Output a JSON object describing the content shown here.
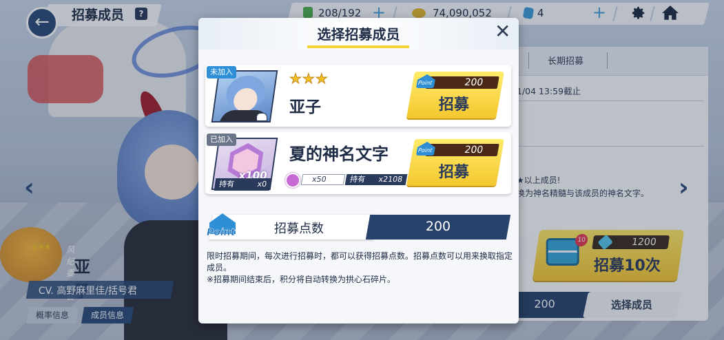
{
  "header": {
    "title": "招募成员",
    "help": "?",
    "resources": {
      "ap": "208/192",
      "credits": "74,090,052",
      "gems": "4"
    }
  },
  "background": {
    "right_panel": {
      "tab_long": "长期招募",
      "deadline": "1/04 13:59截止",
      "desc_line1": "★以上成员!",
      "desc_line2": "换为神名精髓与该成员的神名文字。"
    },
    "recruit10": {
      "badge": "10",
      "cost": "1200",
      "label": "招募10次"
    },
    "points_value": "200",
    "select_member": "选择成员",
    "character": {
      "stars": "★★★",
      "club": "风纪委员会",
      "name": "亚子",
      "cv": "CV. 高野麻里佳/括号君",
      "tab_prob": "概率信息",
      "tab_member": "成员信息"
    }
  },
  "modal": {
    "title": "选择招募成员",
    "close": "✕",
    "cards": [
      {
        "status": "未加入",
        "stars": "★★★",
        "name": "亚子",
        "cost": "200",
        "button": "招募"
      },
      {
        "status": "已加入",
        "name": "夏的神名文字",
        "frag_multiplier": "x100",
        "hold_label": "持有",
        "hold_value": "x0",
        "gem_count": "x50",
        "gem_hold_label": "持有",
        "gem_hold_value": "x2108",
        "cost": "200",
        "button": "招募"
      }
    ],
    "points": {
      "logo": "Point",
      "label": "招募点数",
      "value": "200"
    },
    "description": [
      "限时招募期间，每次进行招募时，都可以获得招募点数。招募点数可以用来换取指定成员。",
      "※招募期间结束后，积分将自动转换为拱心石碎片。"
    ]
  },
  "colors": {
    "accent_yellow": "#f4c72e",
    "navy": "#27426b",
    "blue": "#2e8fd6"
  }
}
